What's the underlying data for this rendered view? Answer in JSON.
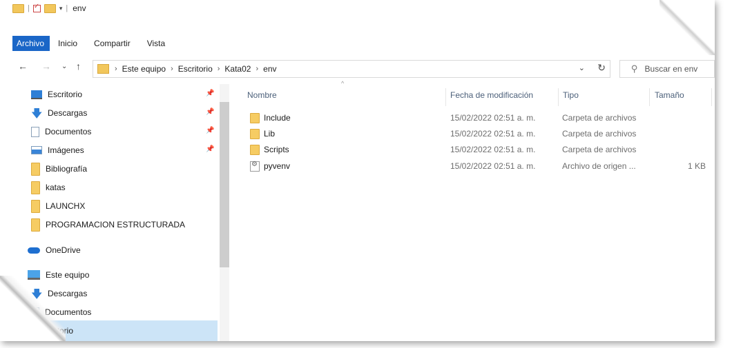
{
  "window": {
    "title": "env"
  },
  "ribbon": {
    "tabs": [
      "Archivo",
      "Inicio",
      "Compartir",
      "Vista"
    ],
    "active": "Archivo"
  },
  "address": {
    "crumbs": [
      "Este equipo",
      "Escritorio",
      "Kata02",
      "env"
    ]
  },
  "search": {
    "placeholder": "Buscar en env"
  },
  "sidebar": {
    "items": [
      {
        "label": "Escritorio",
        "icon": "desktop-icon",
        "pinned": true
      },
      {
        "label": "Descargas",
        "icon": "download-icon",
        "pinned": true
      },
      {
        "label": "Documentos",
        "icon": "document-icon",
        "pinned": true
      },
      {
        "label": "Imágenes",
        "icon": "images-icon",
        "pinned": true
      },
      {
        "label": "Bibliografía",
        "icon": "folder-icon",
        "pinned": false
      },
      {
        "label": "katas",
        "icon": "folder-icon",
        "pinned": false
      },
      {
        "label": "LAUNCHX",
        "icon": "folder-icon",
        "pinned": false
      },
      {
        "label": "PROGRAMACION ESTRUCTURADA",
        "icon": "folder-icon",
        "pinned": false
      },
      {
        "label": "OneDrive",
        "icon": "cloud-icon",
        "pinned": false
      },
      {
        "label": "Este equipo",
        "icon": "computer-icon",
        "pinned": false
      },
      {
        "label": "Descargas",
        "icon": "download-icon",
        "pinned": false
      },
      {
        "label": "Documentos",
        "icon": "document-icon",
        "pinned": false
      },
      {
        "label": "critorio",
        "icon": "desktop-icon",
        "pinned": false
      }
    ]
  },
  "columns": {
    "name": "Nombre",
    "date": "Fecha de modificación",
    "type": "Tipo",
    "size": "Tamaño"
  },
  "files": [
    {
      "name": "Include",
      "date": "15/02/2022 02:51 a. m.",
      "type": "Carpeta de archivos",
      "size": "",
      "icon": "folder-icon"
    },
    {
      "name": "Lib",
      "date": "15/02/2022 02:51 a. m.",
      "type": "Carpeta de archivos",
      "size": "",
      "icon": "folder-icon"
    },
    {
      "name": "Scripts",
      "date": "15/02/2022 02:51 a. m.",
      "type": "Carpeta de archivos",
      "size": "",
      "icon": "folder-icon"
    },
    {
      "name": "pyvenv",
      "date": "15/02/2022 02:51 a. m.",
      "type": "Archivo de origen ...",
      "size": "1 KB",
      "icon": "config-file-icon"
    }
  ]
}
